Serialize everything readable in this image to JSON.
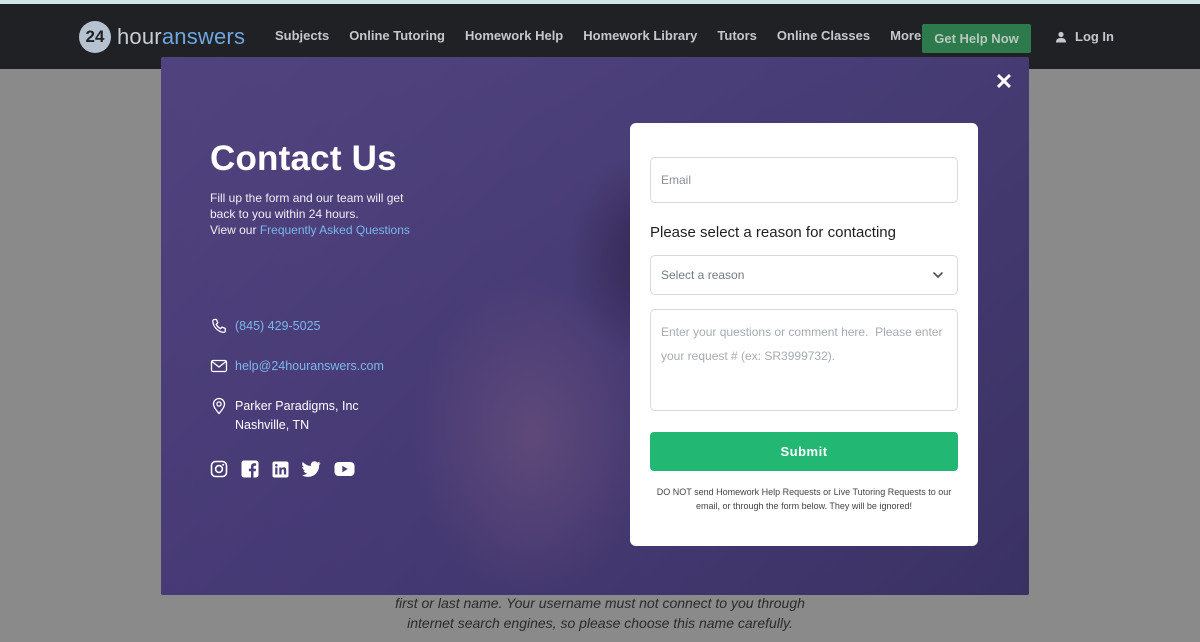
{
  "header": {
    "logo_number": "24",
    "logo_word_1": "hour",
    "logo_word_2": "answers",
    "nav": [
      "Subjects",
      "Online Tutoring",
      "Homework Help",
      "Homework Library",
      "Tutors",
      "Online Classes",
      "More"
    ],
    "more_icon": "chevron-down-icon",
    "cta_label": "Get Help Now",
    "login_label": "Log In"
  },
  "background_text": {
    "line1": "first or last name. Your username must not connect to you through",
    "line2": "internet search engines, so please choose this name carefully."
  },
  "modal": {
    "close_icon": "close-icon",
    "title": "Contact Us",
    "lead_line1": "Fill up the form and our team will get",
    "lead_line2": "back to you within 24 hours.",
    "lead_line3_prefix": "View our ",
    "faq_link": "Frequently Asked Questions",
    "phone": "(845) 429-5025",
    "email": "help@24houranswers.com",
    "address_line1": "Parker Paradigms, Inc",
    "address_line2": "Nashville, TN",
    "socials": [
      "instagram-icon",
      "facebook-icon",
      "linkedin-icon",
      "twitter-icon",
      "youtube-icon"
    ]
  },
  "form": {
    "email_placeholder": "Email",
    "reason_label": "Please select a reason for contacting",
    "reason_selected": "Select a reason",
    "comment_placeholder": "Enter your questions or comment here.  Please enter your request # (ex: SR3999732).",
    "submit_label": "Submit",
    "disclaimer": "DO NOT send Homework Help Requests or Live Tutoring Requests to our email, or through the form below. They will be ignored!"
  },
  "colors": {
    "accent_green": "#22b873",
    "link_blue": "#7cb6ec",
    "navbar": "#1f2124",
    "overlay_purple": "#4a3f78"
  }
}
